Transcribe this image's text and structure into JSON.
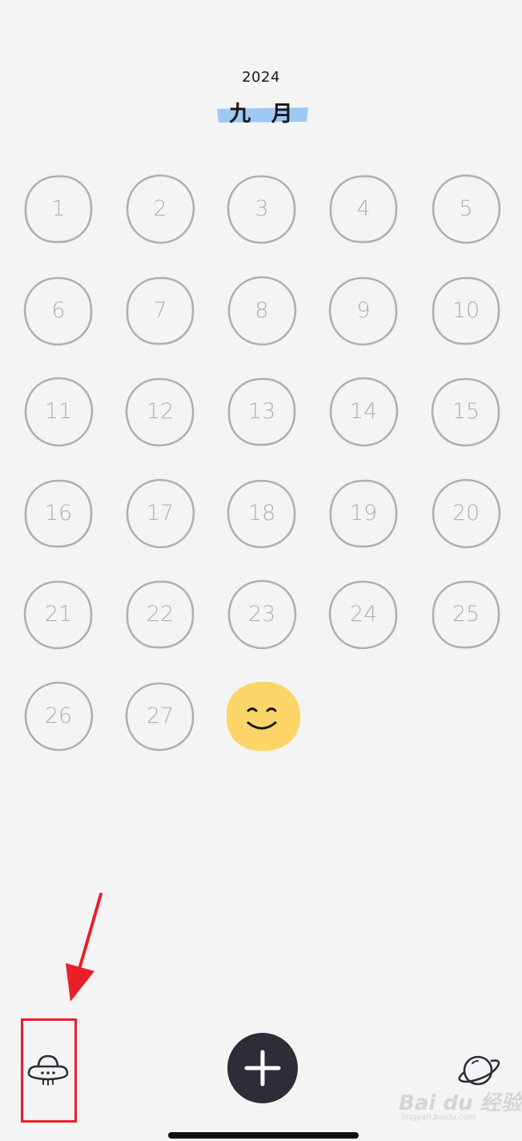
{
  "header": {
    "year": "2024",
    "month": "九 月"
  },
  "calendar": {
    "days": [
      "1",
      "2",
      "3",
      "4",
      "5",
      "6",
      "7",
      "8",
      "9",
      "10",
      "11",
      "12",
      "13",
      "14",
      "15",
      "16",
      "17",
      "18",
      "19",
      "20",
      "21",
      "22",
      "23",
      "24",
      "25",
      "26",
      "27"
    ],
    "today_mood": "smiling-face-icon"
  },
  "tab_bar": {
    "left_icon": "ufo-icon",
    "center_icon": "plus-icon",
    "right_icon": "planet-icon"
  },
  "annotation": {
    "color": "#e8202a"
  },
  "watermark": {
    "main": "Bai du 经验",
    "sub": "jingyan.baidu.com"
  },
  "colors": {
    "background": "#f4f4f4",
    "ring": "#b2b0a8",
    "highlight": "#9ec9f2",
    "today": "#fbd567",
    "button": "#2d2c37"
  }
}
